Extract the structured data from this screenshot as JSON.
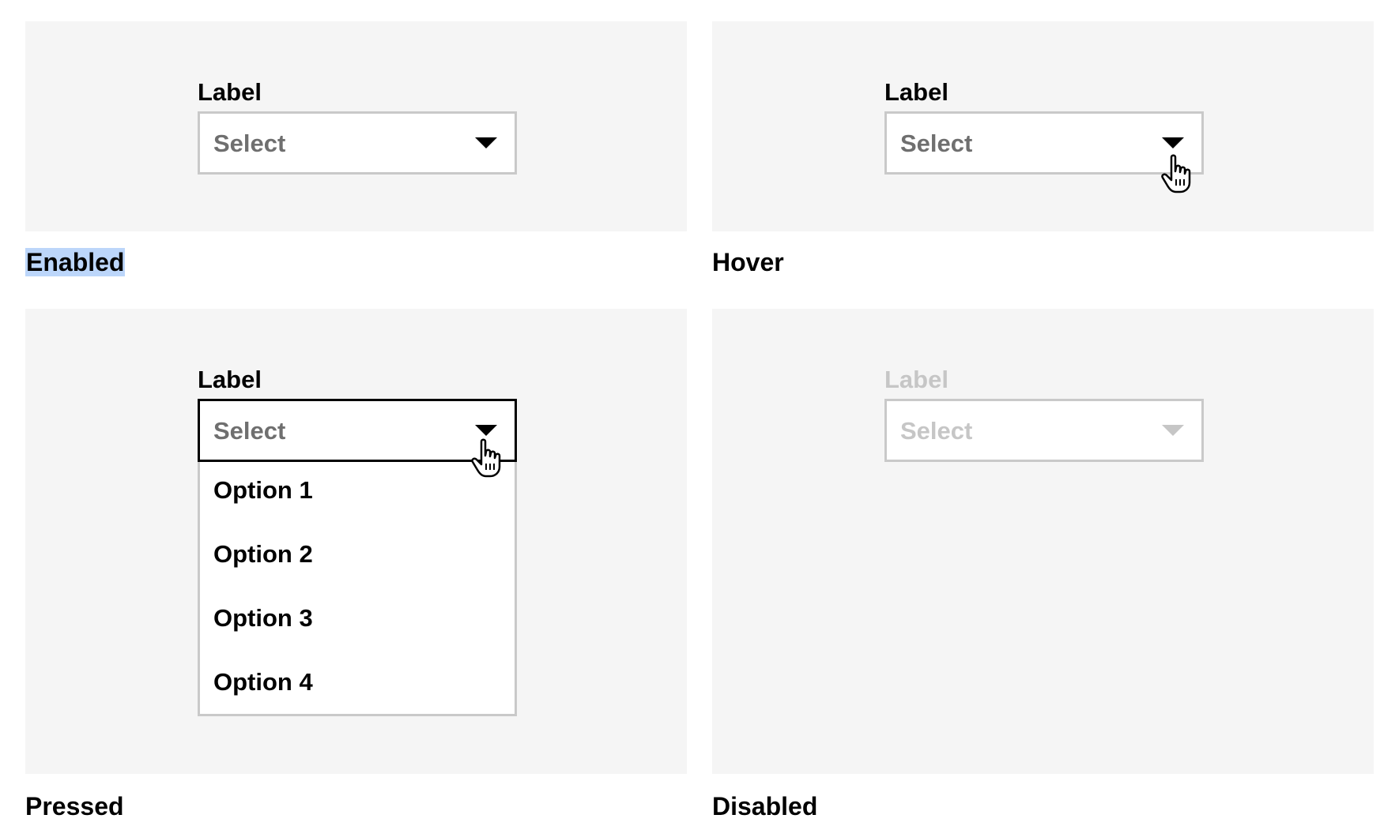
{
  "states": {
    "enabled": {
      "caption": "Enabled",
      "field_label": "Label",
      "select_value": "Select"
    },
    "hover": {
      "caption": "Hover",
      "field_label": "Label",
      "select_value": "Select"
    },
    "pressed": {
      "caption": "Pressed",
      "field_label": "Label",
      "select_value": "Select",
      "options": [
        "Option 1",
        "Option 2",
        "Option 3",
        "Option 4"
      ]
    },
    "disabled": {
      "caption": "Disabled",
      "field_label": "Label",
      "select_value": "Select"
    }
  },
  "colors": {
    "panel_background": "#f5f5f5",
    "border_default": "#c9c9c9",
    "border_pressed": "#000000",
    "placeholder_text": "#6f6f6f",
    "disabled_text": "#c6c6c6",
    "selection_highlight": "#bcd6fa"
  },
  "icons": {
    "chevron": "chevron-down-icon",
    "cursor": "hand-pointer-icon"
  }
}
